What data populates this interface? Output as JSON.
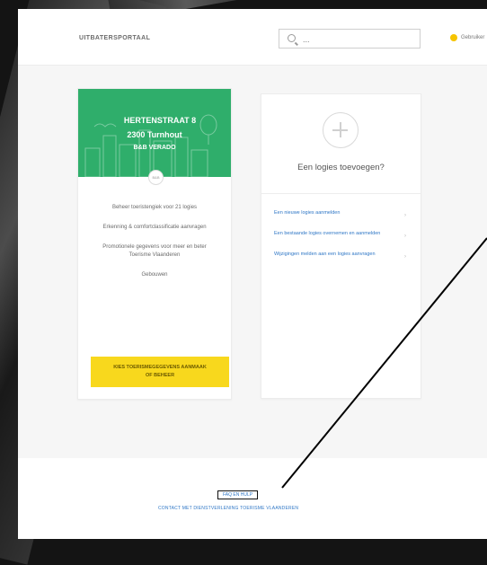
{
  "header": {
    "brand": "UITBATERSPORTAAL",
    "search": {
      "value": "",
      "placeholder": "..."
    },
    "user": {
      "name": "Gebruiker"
    }
  },
  "property_card": {
    "address_line1": "HERTENSTRAAT 8",
    "address_line2": "2300 Turnhout",
    "category": "B&B VERADO",
    "badge": "B&B",
    "links": [
      "Beheer toeristengiek voor 21 logies",
      "Erkenning & comfortclassificatie aanvragen",
      "Promotionele gegevens voor meer en beter Toerisme Vlaanderen",
      "Gebouwen"
    ],
    "cta": "KIES TOERISMEGEGEVENS AANMAAK OF BEHEER"
  },
  "add_card": {
    "title": "Een logies toevoegen?",
    "links": [
      "Een nieuwe logies aanmelden",
      "Een bestaande logies overnemen en aanmelden",
      "Wijzigingen melden aan een logies aanvragen"
    ]
  },
  "footer": {
    "link": "FAQ EN HULP",
    "text": "CONTACT MET DIENSTVERLENING TOERISME VLAANDEREN"
  },
  "colors": {
    "accent_green": "#2fae6b",
    "accent_yellow": "#f8d81d",
    "link_blue": "#2f77c6"
  }
}
